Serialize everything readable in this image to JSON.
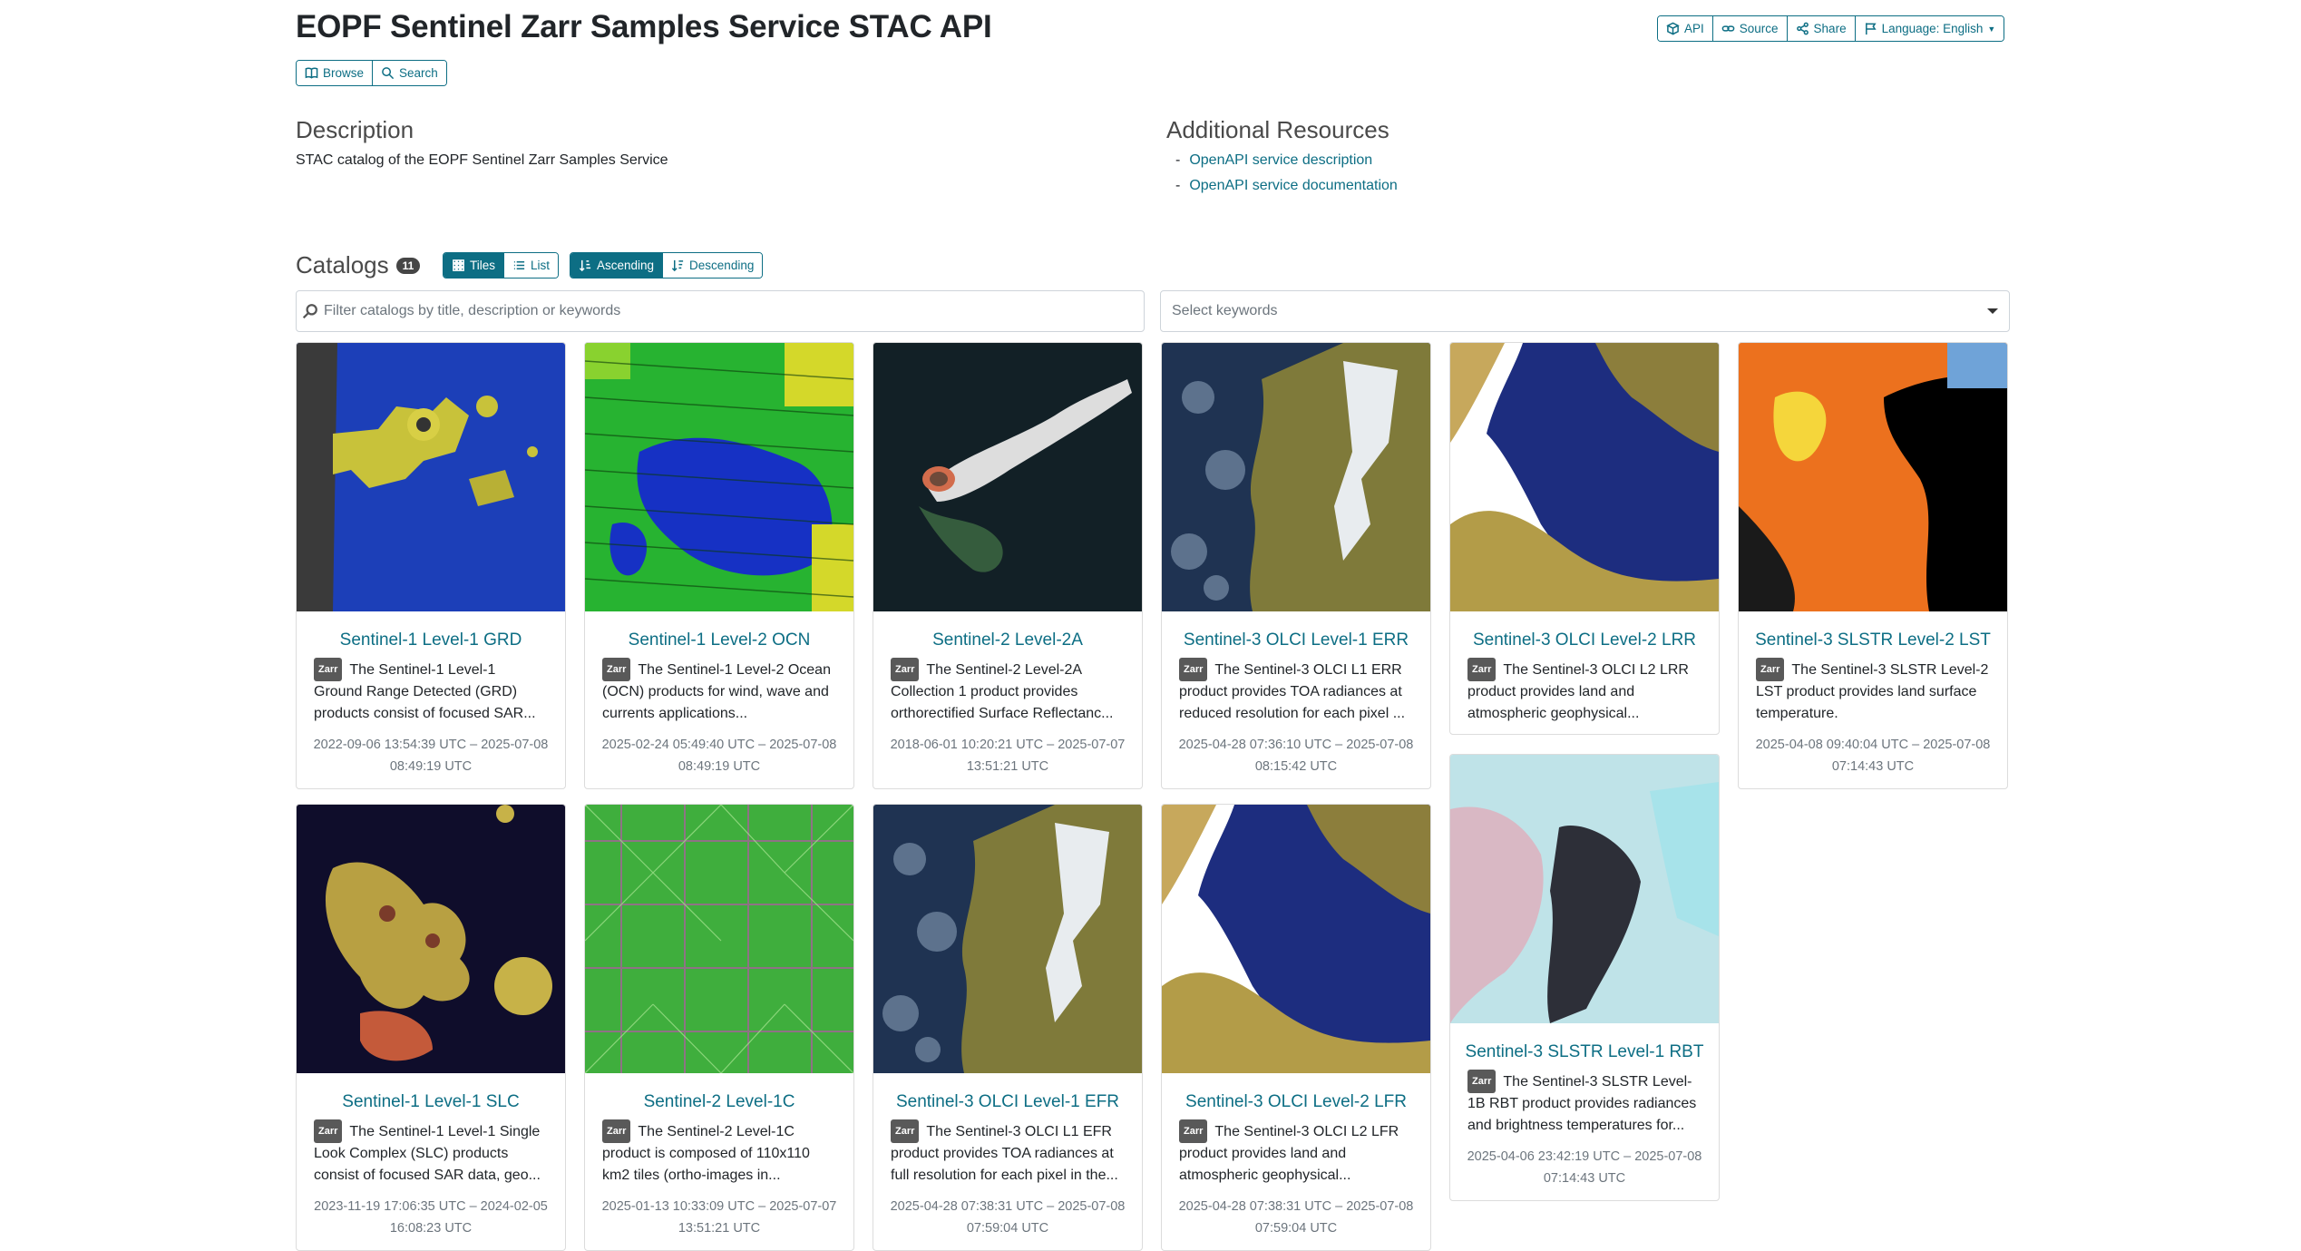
{
  "header": {
    "title": "EOPF Sentinel Zarr Samples Service STAC API",
    "api_label": "API",
    "source_label": "Source",
    "share_label": "Share",
    "language_label": "Language: English"
  },
  "subnav": {
    "browse_label": "Browse",
    "search_label": "Search"
  },
  "description": {
    "heading": "Description",
    "text": "STAC catalog of the EOPF Sentinel Zarr Samples Service"
  },
  "resources": {
    "heading": "Additional Resources",
    "links": [
      "OpenAPI service description",
      "OpenAPI service documentation"
    ]
  },
  "catalogs": {
    "heading": "Catalogs",
    "count": "11",
    "view_tiles": "Tiles",
    "view_list": "List",
    "sort_asc": "Ascending",
    "sort_desc": "Descending",
    "filter_placeholder": "Filter catalogs by title, description or keywords",
    "keywords_placeholder": "Select keywords",
    "badge_label": "Zarr",
    "items": [
      {
        "title": "Sentinel-1 Level-1 GRD",
        "desc": "The Sentinel-1 Level-1 Ground Range Detected (GRD) products consist of focused SAR...",
        "date": "2022-09-06 13:54:39 UTC – 2025-07-08 08:49:19 UTC"
      },
      {
        "title": "Sentinel-1 Level-2 OCN",
        "desc": "The Sentinel-1 Level-2 Ocean (OCN) products for wind, wave and currents applications...",
        "date": "2025-02-24 05:49:40 UTC – 2025-07-08 08:49:19 UTC"
      },
      {
        "title": "Sentinel-2 Level-2A",
        "desc": "The Sentinel-2 Level-2A Collection 1 product provides orthorectified Surface Reflectanc...",
        "date": "2018-06-01 10:20:21 UTC – 2025-07-07 13:51:21 UTC"
      },
      {
        "title": "Sentinel-3 OLCI Level-1 ERR",
        "desc": "The Sentinel-3 OLCI L1 ERR product provides TOA radiances at reduced resolution for each pixel ...",
        "date": "2025-04-28 07:36:10 UTC – 2025-07-08 08:15:42 UTC"
      },
      {
        "title": "Sentinel-3 OLCI Level-2 LRR",
        "desc": "The Sentinel-3 OLCI L2 LRR product provides land and atmospheric geophysical...",
        "date": ""
      },
      {
        "title": "Sentinel-3 SLSTR Level-2 LST",
        "desc": "The Sentinel-3 SLSTR Level-2 LST product provides land surface temperature.",
        "date": "2025-04-08 09:40:04 UTC – 2025-07-08 07:14:43 UTC"
      },
      {
        "title": "Sentinel-1 Level-1 SLC",
        "desc": "The Sentinel-1 Level-1 Single Look Complex (SLC) products consist of focused SAR data, geo...",
        "date": "2023-11-19 17:06:35 UTC – 2024-02-05 16:08:23 UTC"
      },
      {
        "title": "Sentinel-2 Level-1C",
        "desc": "The Sentinel-2 Level-1C product is composed of 110x110 km2 tiles (ortho-images in...",
        "date": "2025-01-13 10:33:09 UTC – 2025-07-07 13:51:21 UTC"
      },
      {
        "title": "Sentinel-3 OLCI Level-1 EFR",
        "desc": "The Sentinel-3 OLCI L1 EFR product provides TOA radiances at full resolution for each pixel in the...",
        "date": "2025-04-28 07:38:31 UTC – 2025-07-08 07:59:04 UTC"
      },
      {
        "title": "Sentinel-3 OLCI Level-2 LFR",
        "desc": "The Sentinel-3 OLCI L2 LFR product provides land and atmospheric geophysical...",
        "date": "2025-04-28 07:38:31 UTC – 2025-07-08 07:59:04 UTC"
      },
      {
        "title": "Sentinel-3 SLSTR Level-1 RBT",
        "desc": "The Sentinel-3 SLSTR Level-1B RBT product provides radiances and brightness temperatures for...",
        "date": "2025-04-06 23:42:19 UTC – 2025-07-08 07:14:43 UTC"
      }
    ]
  },
  "colors": {
    "accent": "#0d6e84",
    "badge": "#595959"
  }
}
